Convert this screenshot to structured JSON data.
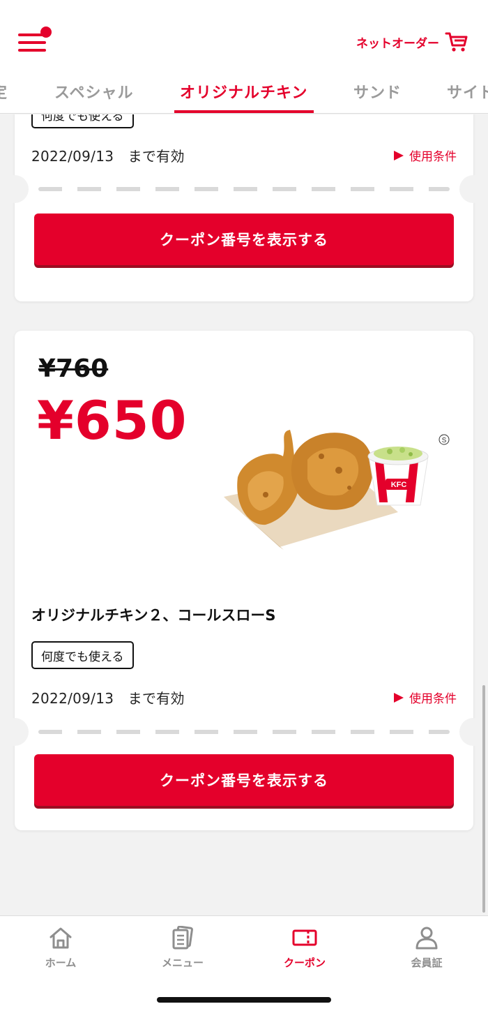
{
  "header": {
    "net_order_label": "ネットオーダー"
  },
  "tabs": [
    {
      "label": "定"
    },
    {
      "label": "スペシャル"
    },
    {
      "label": "オリジナルチキン"
    },
    {
      "label": "サンド"
    },
    {
      "label": "サイド"
    }
  ],
  "active_tab": "オリジナルチキン",
  "coupons": [
    {
      "badge": "何度でも使える",
      "valid_until": "2022/09/13　まで有効",
      "terms_label": "使用条件",
      "button_label": "クーポン番号を表示する"
    },
    {
      "old_price": "¥760",
      "new_price": "¥650",
      "product_name": "オリジナルチキン２、コールスローS",
      "badge": "何度でも使える",
      "valid_until": "2022/09/13　まで有効",
      "terms_label": "使用条件",
      "button_label": "クーポン番号を表示する",
      "image_logo_text": "KFC",
      "size_mark": "S"
    }
  ],
  "bottom_nav": [
    {
      "label": "ホーム",
      "icon": "home-icon"
    },
    {
      "label": "メニュー",
      "icon": "menu-book-icon"
    },
    {
      "label": "クーポン",
      "icon": "coupon-icon"
    },
    {
      "label": "会員証",
      "icon": "member-icon"
    }
  ],
  "colors": {
    "accent": "#e4002b",
    "inactive": "#9a9a9a",
    "background": "#f2f2f2"
  }
}
